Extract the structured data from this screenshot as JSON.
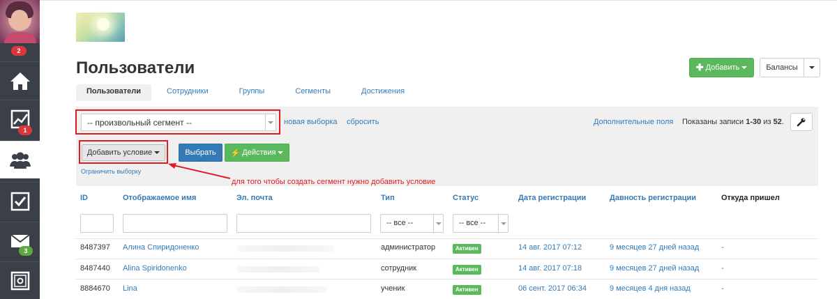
{
  "sidebar": {
    "avatar_badge": "2",
    "items": [
      {
        "icon": "home-icon",
        "badge": ""
      },
      {
        "icon": "chart-icon",
        "badge": "1"
      },
      {
        "icon": "users-icon",
        "badge": ""
      },
      {
        "icon": "checkbox-icon",
        "badge": ""
      },
      {
        "icon": "mail-icon",
        "badge": "3"
      },
      {
        "icon": "safe-icon",
        "badge": ""
      }
    ]
  },
  "header": {
    "title": "Пользователи",
    "add_label": "Добавить",
    "balances_label": "Балансы"
  },
  "tabs": [
    {
      "label": "Пользователи",
      "active": true
    },
    {
      "label": "Сотрудники",
      "active": false
    },
    {
      "label": "Группы",
      "active": false
    },
    {
      "label": "Сегменты",
      "active": false
    },
    {
      "label": "Достижения",
      "active": false
    }
  ],
  "filter": {
    "segment_value": "-- произвольный сегмент --",
    "new_selection": "новая выборка",
    "reset": "сбросить",
    "extra_fields": "Дополнительные поля",
    "records_prefix": "Показаны записи",
    "records_range": "1-30",
    "records_of": "из",
    "records_total": "52",
    "records_dot": ".",
    "add_condition": "Добавить условие",
    "choose": "Выбрать",
    "actions": "Действия",
    "limit_selection": "Ограничить выборку",
    "annotation": "для того чтобы создать сегмент нужно добавить условие"
  },
  "table": {
    "columns": [
      "ID",
      "Отображаемое имя",
      "Эл. почта",
      "Тип",
      "Статус",
      "Дата регистрации",
      "Давность регистрации",
      "Откуда пришел"
    ],
    "type_filter": "-- все --",
    "status_filter": "-- все --",
    "rows": [
      {
        "id": "8487397",
        "name": "Алина Спиридоненко",
        "type": "администратор",
        "status": "Активен",
        "date": "14 авг. 2017 07:12",
        "ago": "9 месяцев 27 дней назад",
        "source": "-"
      },
      {
        "id": "8487440",
        "name": "Alina Spiridonenko",
        "type": "сотрудник",
        "status": "Активен",
        "date": "14 авг. 2017 07:18",
        "ago": "9 месяцев 27 дней назад",
        "source": "-"
      },
      {
        "id": "8884670",
        "name": "Lina",
        "type": "ученик",
        "status": "Активен",
        "date": "06 сент. 2017 06:34",
        "ago": "9 месяцев 4 дня назад",
        "source": "-"
      }
    ]
  },
  "colors": {
    "sidebar_bg": "#3a3f48",
    "link_blue": "#337ab7",
    "green": "#5cb85c",
    "annotation_red": "#e01b24"
  }
}
